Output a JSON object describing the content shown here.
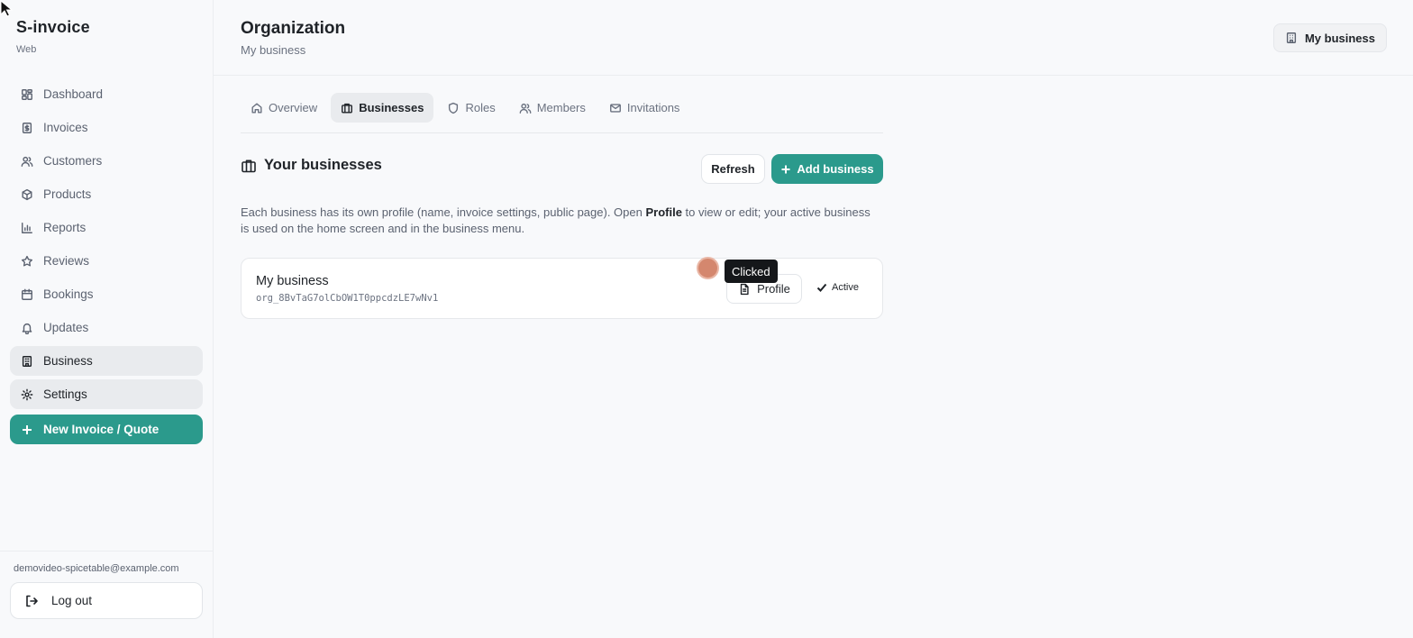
{
  "brand": {
    "name": "S-invoice",
    "sub": "Web"
  },
  "sidebar": {
    "items": [
      {
        "label": "Dashboard",
        "icon": "dashboard-icon"
      },
      {
        "label": "Invoices",
        "icon": "invoice-icon"
      },
      {
        "label": "Customers",
        "icon": "customers-icon"
      },
      {
        "label": "Products",
        "icon": "box-icon"
      },
      {
        "label": "Reports",
        "icon": "bar-chart-icon"
      },
      {
        "label": "Reviews",
        "icon": "star-icon"
      },
      {
        "label": "Bookings",
        "icon": "calendar-icon"
      },
      {
        "label": "Updates",
        "icon": "bell-icon"
      },
      {
        "label": "Business",
        "icon": "building-icon",
        "active": true
      },
      {
        "label": "Settings",
        "icon": "gear-icon",
        "active": true
      }
    ],
    "new_invoice_label": "New Invoice / Quote",
    "email": "demovideo-spicetable@example.com",
    "logout_label": "Log out"
  },
  "header": {
    "title": "Organization",
    "subtitle": "My business",
    "business_switch_label": "My business"
  },
  "tabs": [
    {
      "label": "Overview",
      "icon": "home-icon"
    },
    {
      "label": "Businesses",
      "icon": "briefcase-icon",
      "active": true
    },
    {
      "label": "Roles",
      "icon": "shield-icon"
    },
    {
      "label": "Members",
      "icon": "users-icon"
    },
    {
      "label": "Invitations",
      "icon": "mail-icon"
    }
  ],
  "section": {
    "title": "Your businesses",
    "refresh_label": "Refresh",
    "add_label": "Add business",
    "desc_before": "Each business has its own profile (name, invoice settings, public page). Open ",
    "desc_bold": "Profile",
    "desc_after": " to view or edit; your active business is used on the home screen and in the business menu."
  },
  "businesses": [
    {
      "name": "My business",
      "id": "org_8BvTaG7olCbOW1T0ppcdzLE7wNv1",
      "profile_label": "Profile",
      "status": "Active"
    }
  ],
  "overlay": {
    "tooltip": "Clicked"
  },
  "colors": {
    "accent": "#2b9a8c",
    "click_marker": "#d4876e"
  }
}
